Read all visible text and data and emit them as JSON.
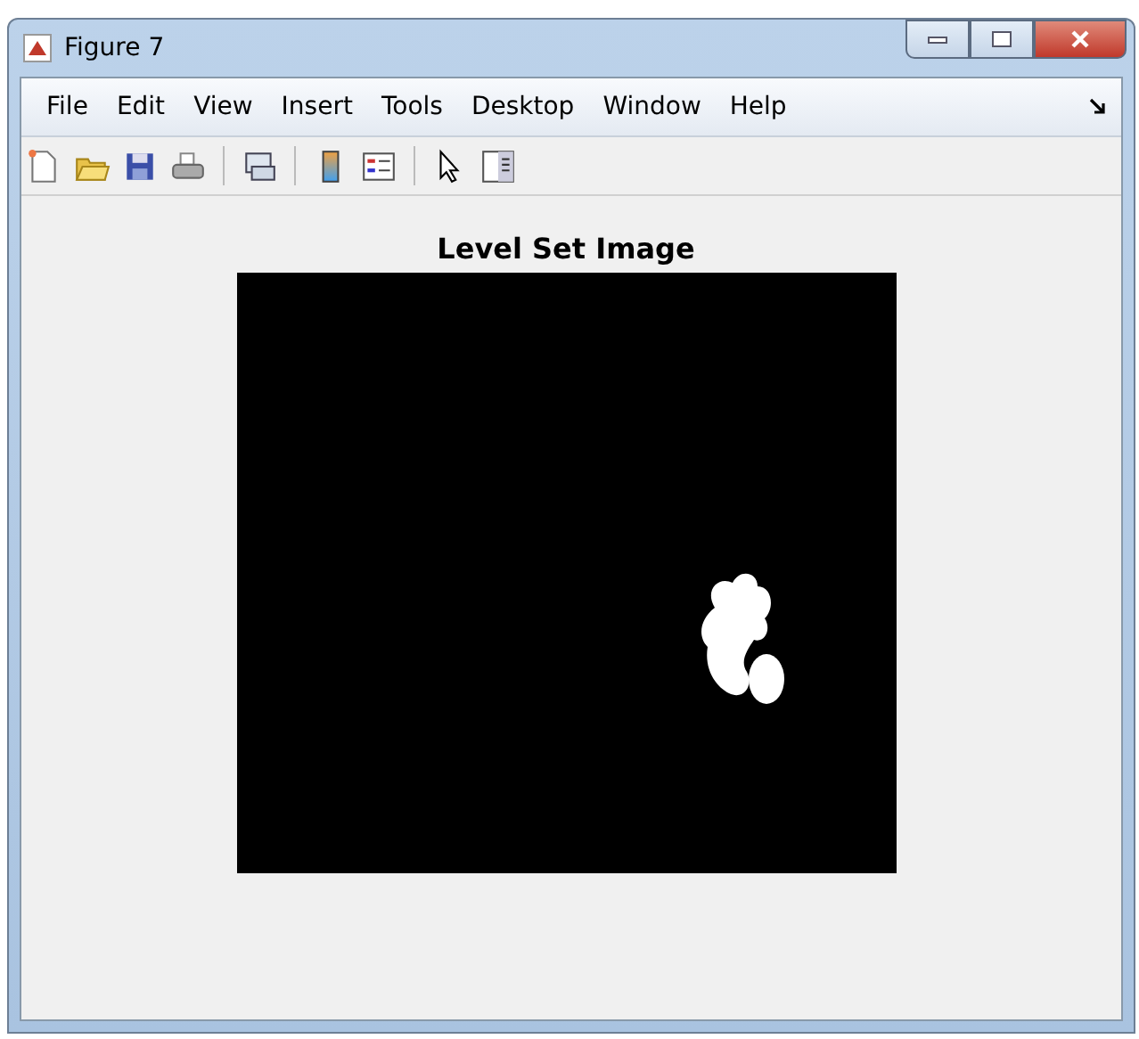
{
  "window": {
    "title": "Figure 7"
  },
  "menu": [
    "File",
    "Edit",
    "View",
    "Insert",
    "Tools",
    "Desktop",
    "Window",
    "Help"
  ],
  "toolbar": [
    {
      "kind": "new"
    },
    {
      "kind": "open"
    },
    {
      "kind": "save"
    },
    {
      "kind": "print"
    },
    {
      "kind": "sep"
    },
    {
      "kind": "link"
    },
    {
      "kind": "sep"
    },
    {
      "kind": "colorbar"
    },
    {
      "kind": "legend"
    },
    {
      "kind": "sep"
    },
    {
      "kind": "pointer"
    },
    {
      "kind": "panel"
    }
  ],
  "axes": {
    "title": "Level Set Image"
  }
}
